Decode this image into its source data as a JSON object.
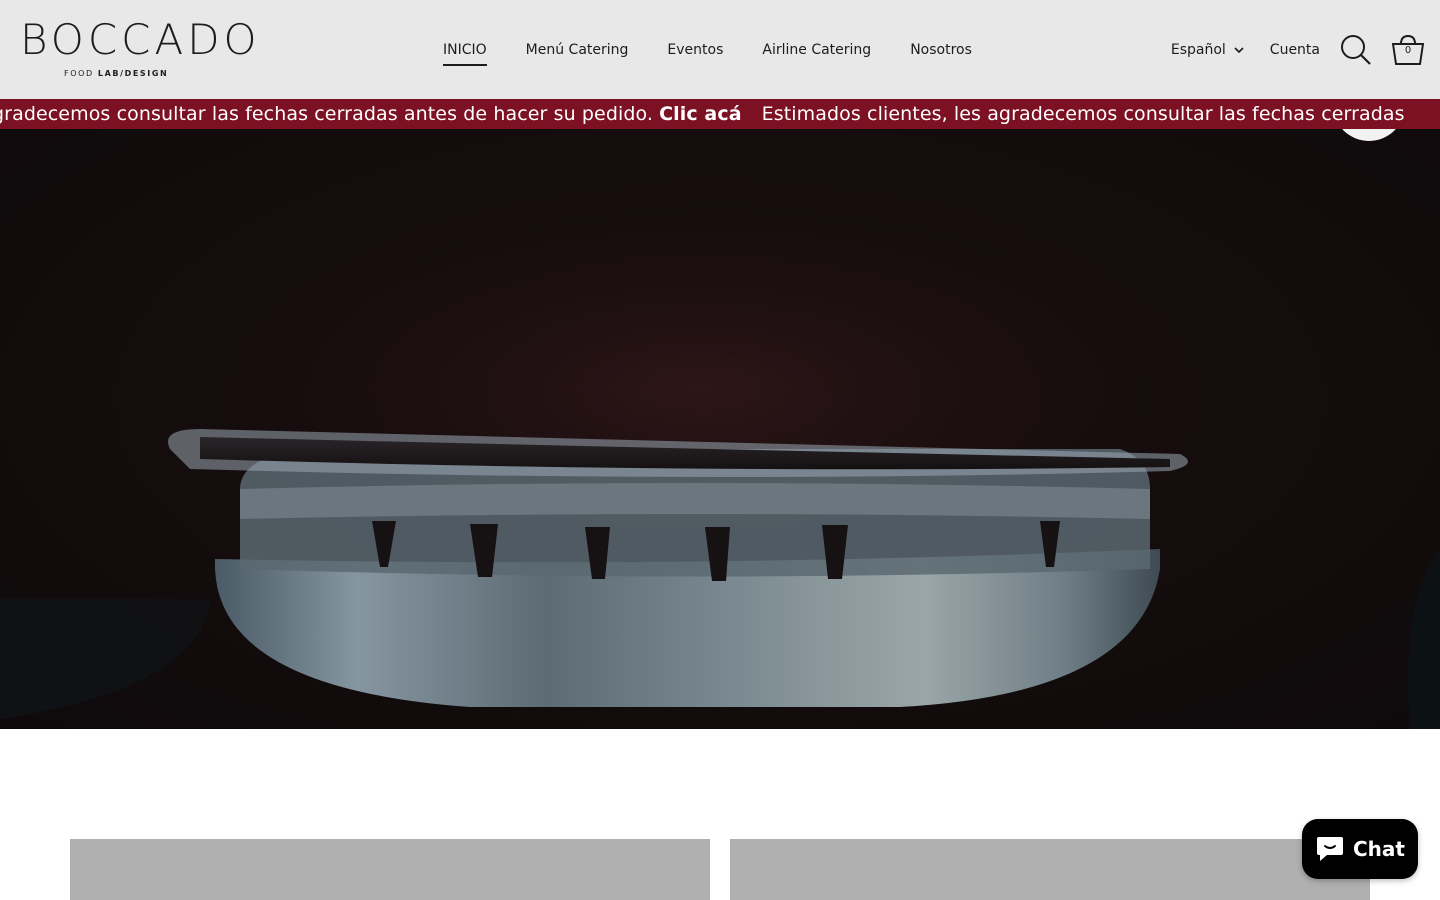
{
  "brand": {
    "logo_text": "BOCCADO",
    "logo_sub_light": "FOOD",
    "logo_sub_bold": "LAB/DESIGN"
  },
  "nav": {
    "items": [
      {
        "label": "INICIO",
        "active": true
      },
      {
        "label": "Menú Catering",
        "active": false
      },
      {
        "label": "Eventos",
        "active": false
      },
      {
        "label": "Airline Catering",
        "active": false
      },
      {
        "label": "Nosotros",
        "active": false
      }
    ]
  },
  "tools": {
    "language": "Español",
    "account": "Cuenta",
    "cart_count": "0"
  },
  "announcement": {
    "text_start": "gradecemos consultar las fechas cerradas antes de hacer su pedido.",
    "link": "Clic acá",
    "text_repeat": "Estimados clientes, les agradecemos consultar las fechas cerradas"
  },
  "chat": {
    "label": "Chat"
  },
  "colors": {
    "header_bg": "#e8e8e8",
    "announcement_bg": "#7c1124",
    "chat_bg": "#000000",
    "card_placeholder": "#b0b0b0"
  }
}
